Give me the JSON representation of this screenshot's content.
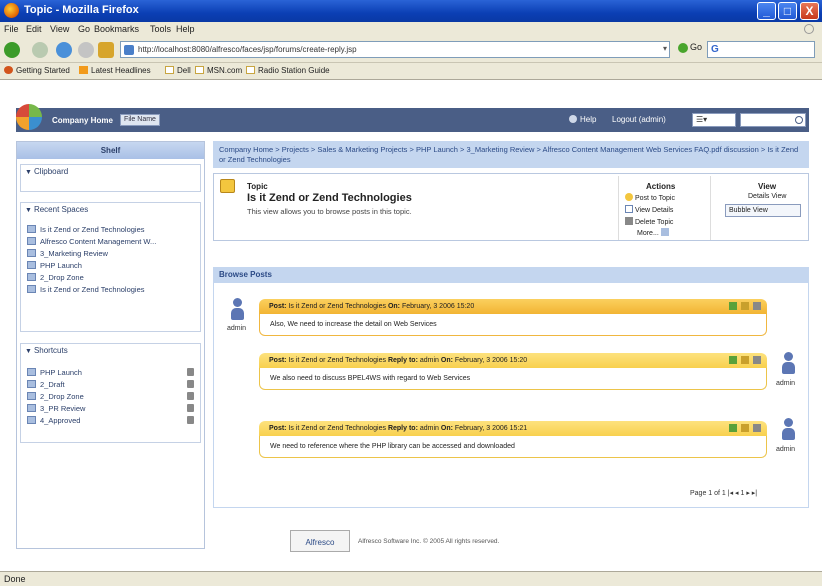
{
  "window": {
    "title": "Topic - Mozilla Firefox",
    "min": "_",
    "max": "□",
    "close": "X"
  },
  "menu": [
    "File",
    "Edit",
    "View",
    "Go",
    "Bookmarks",
    "Tools",
    "Help"
  ],
  "nav": {
    "url": "http://localhost:8080/alfresco/faces/jsp/forums/create-reply.jsp",
    "go_label": "Go",
    "search_engine": "G"
  },
  "bookmarks": [
    "Getting Started",
    "Latest Headlines",
    "Dell",
    "MSN.com",
    "Radio Station Guide"
  ],
  "alfresco": {
    "company_home": "Company Home",
    "file_name_btn": "File Name",
    "help": "Help",
    "logout": "Logout (admin)",
    "view_select": "☰▾"
  },
  "shelf": {
    "title": "Shelf",
    "clipboard": "Clipboard",
    "recent_spaces": "Recent Spaces",
    "recent_items": [
      "Is it Zend or Zend Technologies",
      "Alfresco Content Management W...",
      "3_Marketing Review",
      "PHP Launch",
      "2_Drop Zone",
      "Is it Zend or Zend Technologies"
    ],
    "shortcuts": "Shortcuts",
    "shortcut_items": [
      "PHP Launch",
      "2_Draft",
      "2_Drop Zone",
      "3_PR Review",
      "4_Approved"
    ]
  },
  "breadcrumb": "Company Home > Projects > Sales & Marketing Projects > PHP Launch > 3_Marketing Review > Alfresco Content Management Web Services FAQ.pdf discussion > Is it Zend or Zend Technologies",
  "topic": {
    "label": "Topic",
    "title": "Is it Zend or Zend Technologies",
    "desc": "This view allows you to browse posts in this topic.",
    "actions_title": "Actions",
    "actions": [
      "Post to Topic",
      "View Details",
      "Delete Topic",
      "More..."
    ],
    "view_title": "View",
    "details_view": "Details View",
    "bubble_view": "Bubble View"
  },
  "browse_posts": "Browse Posts",
  "posts": [
    {
      "header_post": "Post:",
      "header_text": "Is it Zend or Zend Technologies",
      "on_label": "On:",
      "date": "February, 3 2006 15:20",
      "body": "Also, We need to increase the detail on Web Services",
      "author": "admin"
    },
    {
      "header_post": "Post:",
      "header_text": "Is it Zend or Zend Technologies",
      "reply_label": "Reply to:",
      "reply_to": "admin",
      "on_label": "On:",
      "date": "February, 3 2006 15:20",
      "body": "We also need to discuss BPEL4WS with regard to Web Services",
      "author": "admin"
    },
    {
      "header_post": "Post:",
      "header_text": "Is it Zend or Zend Technologies",
      "reply_label": "Reply to:",
      "reply_to": "admin",
      "on_label": "On:",
      "date": "February, 3 2006 15:21",
      "body": "We need to reference where the PHP library can be accessed and downloaded",
      "author": "admin"
    }
  ],
  "pager": "Page 1 of 1  |◂ ◂ 1 ▸ ▸|",
  "footer": {
    "logo": "Alfresco",
    "text": "Alfresco Software Inc. © 2005 All rights reserved."
  },
  "status": "Done"
}
